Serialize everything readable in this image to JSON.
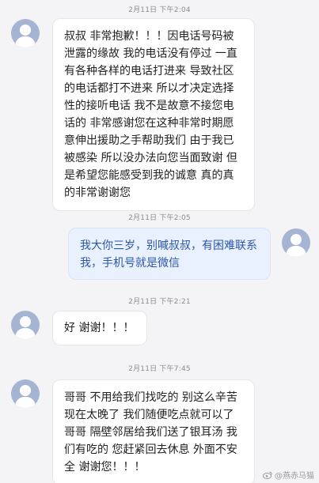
{
  "conversation": [
    {
      "timestamp": "2月11日 下午2:04",
      "sender": "other",
      "avatar_icon": "default-user-avatar-icon",
      "text": "叔叔 非常抱歉！！！因电话号码被泄露的缘故 我的电话没有停过 一直有各种各样的电话打进来 导致社区的电话都打不进来 所以才决定选择性的接听电话 我不是故意不接您电话的 非常感谢您在这种非常时期愿意伸出援助之手帮助我们 由于我已被感染 所以没办法向您当面致谢 但是希望您能感受到我的诚意 真的真的非常谢谢您"
    },
    {
      "timestamp": "2月11日 下午2:05",
      "sender": "self",
      "avatar_icon": "default-user-avatar-icon",
      "text": "我大你三岁，别喊叔叔，有困难联系我，手机号就是微信"
    },
    {
      "timestamp": "2月11日 下午2:21",
      "sender": "other",
      "avatar_icon": "default-user-avatar-icon",
      "text": "好 谢谢！！！"
    },
    {
      "timestamp": "2月11日 下午7:45",
      "sender": "other",
      "avatar_icon": "default-user-avatar-icon",
      "text": "哥哥 不用给我们找吃的 别这么辛苦 现在太晚了 我们随便吃点就可以了 哥哥 隔壁邻居给我们送了银耳汤 我们有吃的 您赶紧回去休息 外面不安全 谢谢您！！！"
    }
  ],
  "watermark": {
    "icon": "weibo-logo-icon",
    "text": "@燕赤马猫"
  },
  "colors": {
    "background": "#f4f4f6",
    "incoming_bubble": "#ffffff",
    "outgoing_bubble": "#e9f1fe",
    "outgoing_text": "#2b56a8",
    "avatar": "#a6b4d4"
  }
}
